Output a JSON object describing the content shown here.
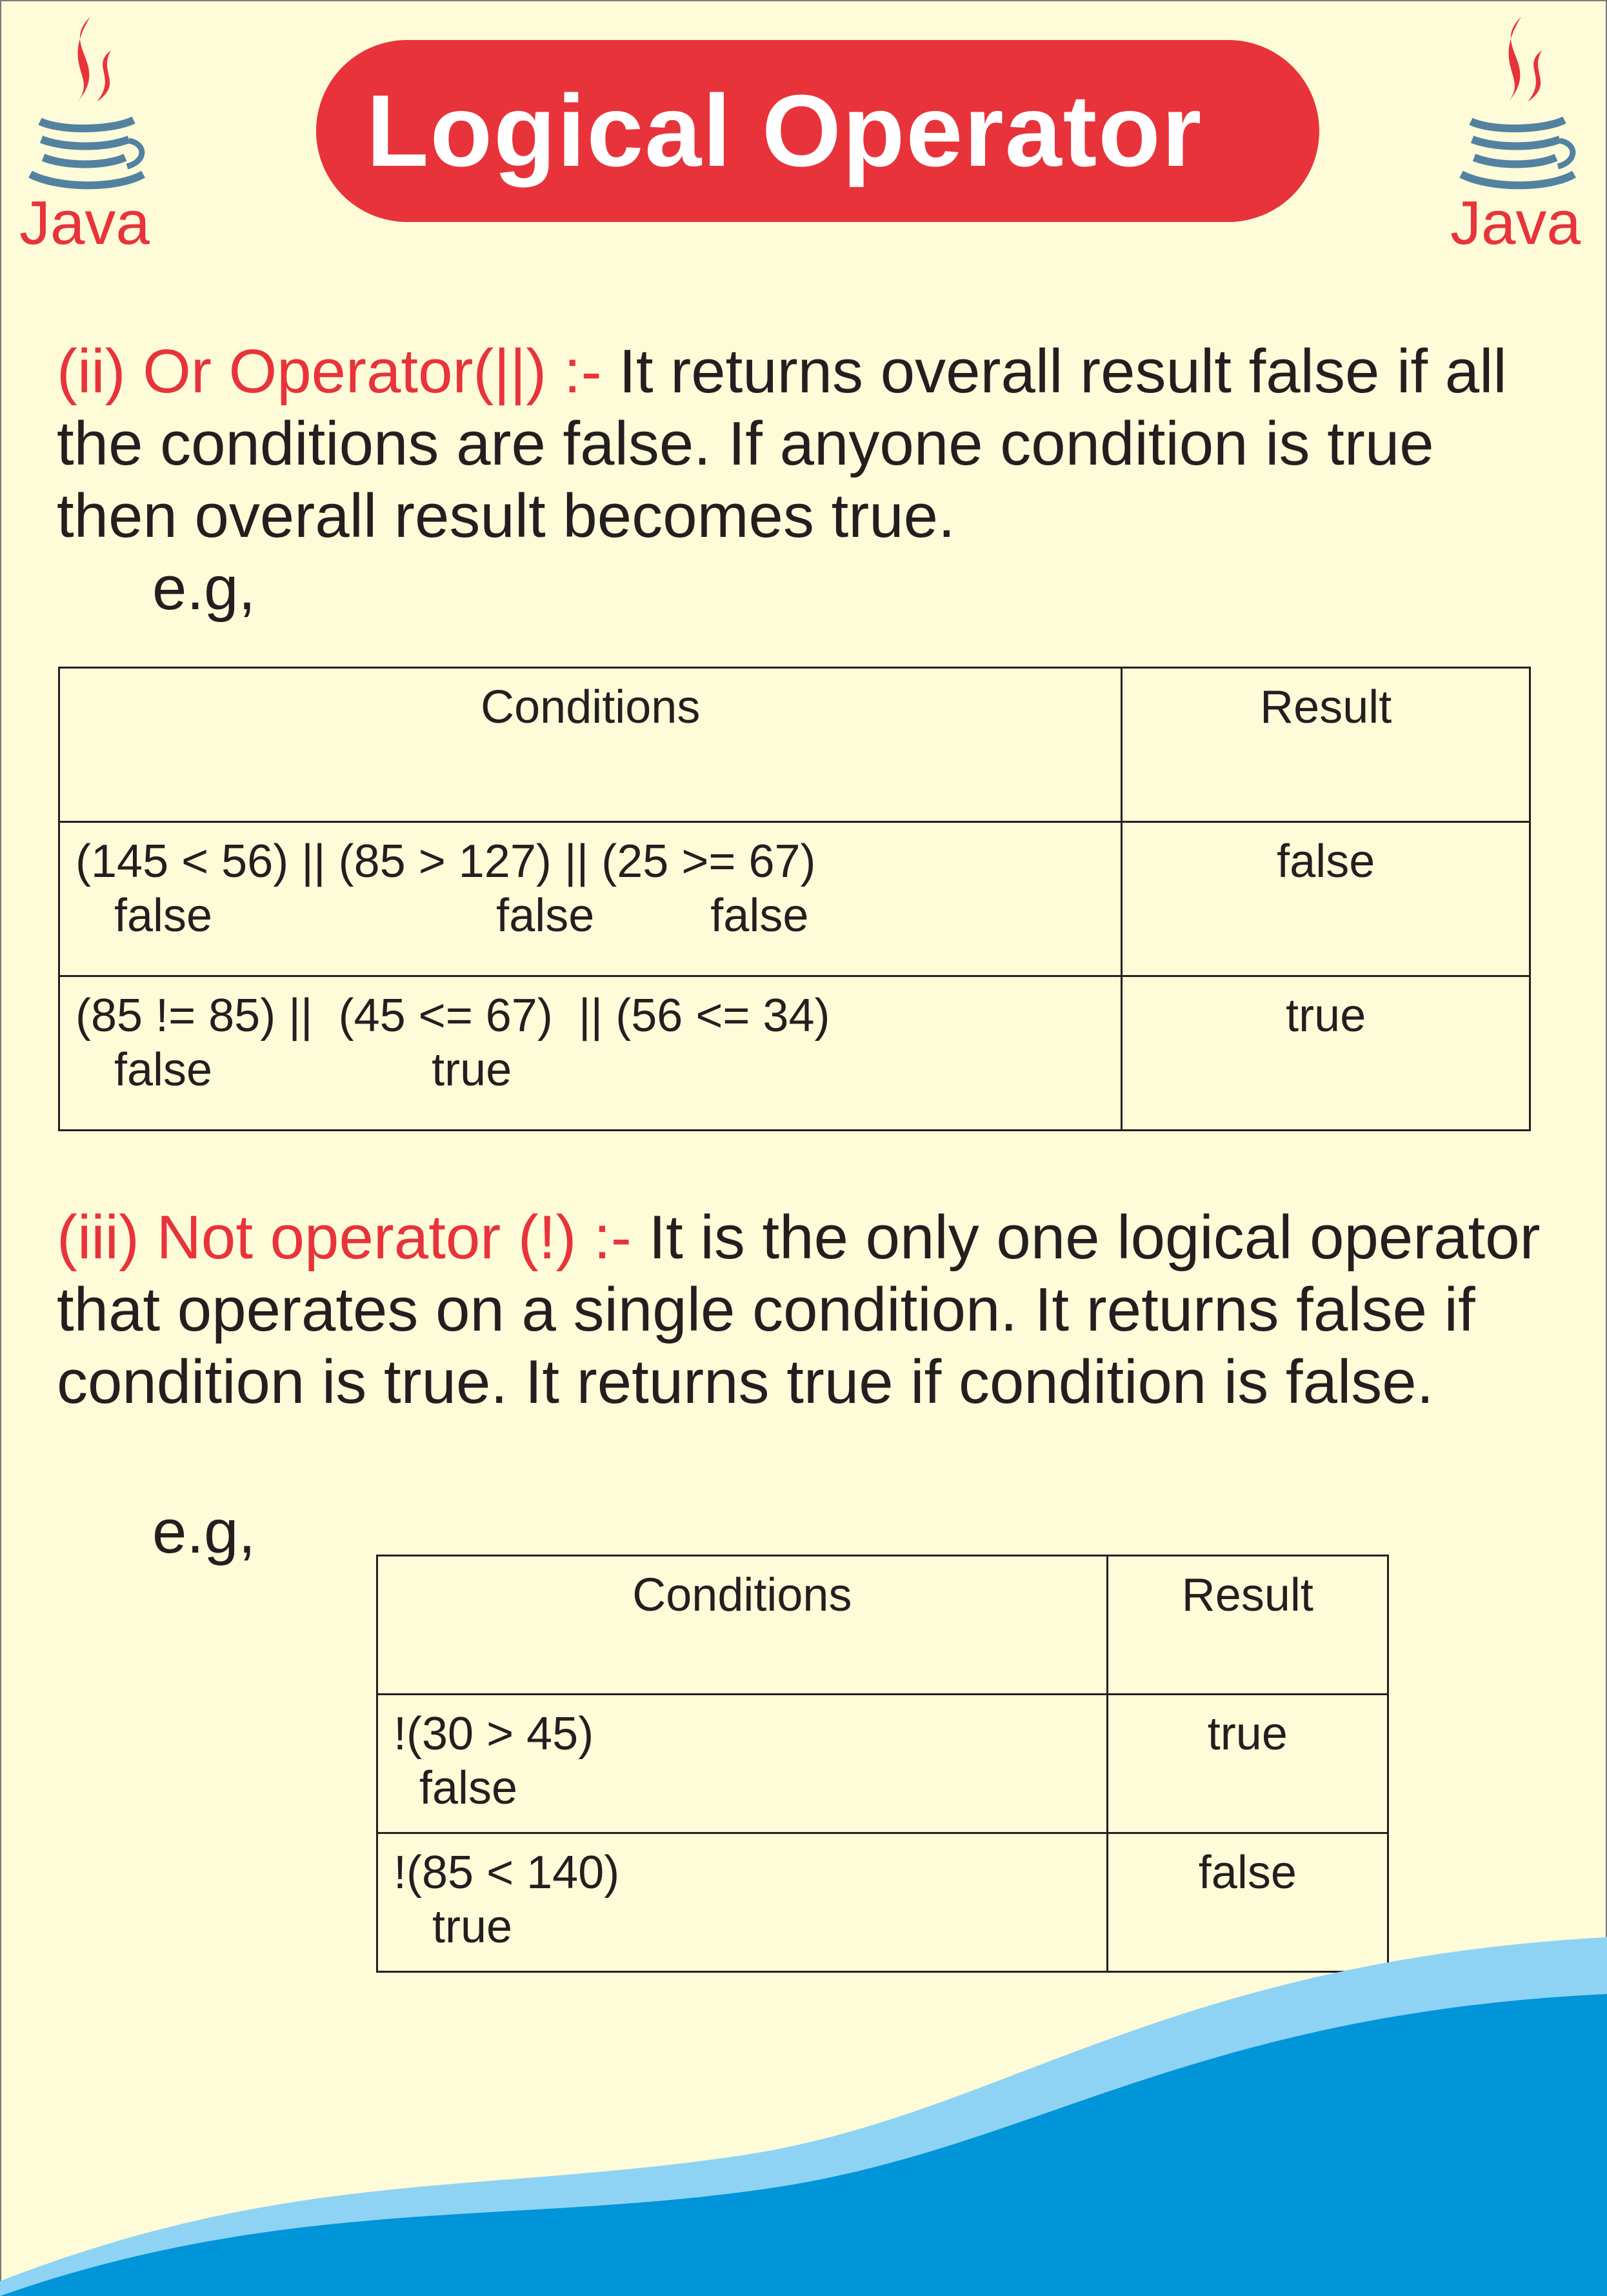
{
  "title": "Logical Operator",
  "logo_text": "Java",
  "colors": {
    "background": "#fdfbd8",
    "accent_red": "#e8333b",
    "java_blue": "#5382a1",
    "wave_light": "#8fd3f4",
    "wave_dark": "#0095d8"
  },
  "or_section": {
    "lead": "(ii) Or Operator(||) :-",
    "text": " It returns overall result false if all the conditions are false. If anyone condition is true then overall result becomes true.",
    "eg": "e.g,",
    "table": {
      "headers": [
        "Conditions",
        "Result"
      ],
      "rows": [
        {
          "condition": "(145 < 56) || (85 > 127) || (25 >= 67)",
          "evaluation": "   false                      false         false",
          "result": "false"
        },
        {
          "condition": "(85 != 85) ||  (45 <= 67)  || (56 <= 34)",
          "evaluation": "   false                 true",
          "result": "true"
        }
      ]
    }
  },
  "not_section": {
    "lead": "(iii) Not operator (!) :-",
    "text": " It is the only one logical operator that operates on a single condition. It returns false if condition is true. It returns true if condition is false.",
    "eg": "e.g,",
    "table": {
      "headers": [
        "Conditions",
        "Result"
      ],
      "rows": [
        {
          "condition": "!(30 > 45)",
          "evaluation": "  false",
          "result": "true"
        },
        {
          "condition": "!(85 < 140)",
          "evaluation": "   true",
          "result": "false"
        }
      ]
    }
  }
}
